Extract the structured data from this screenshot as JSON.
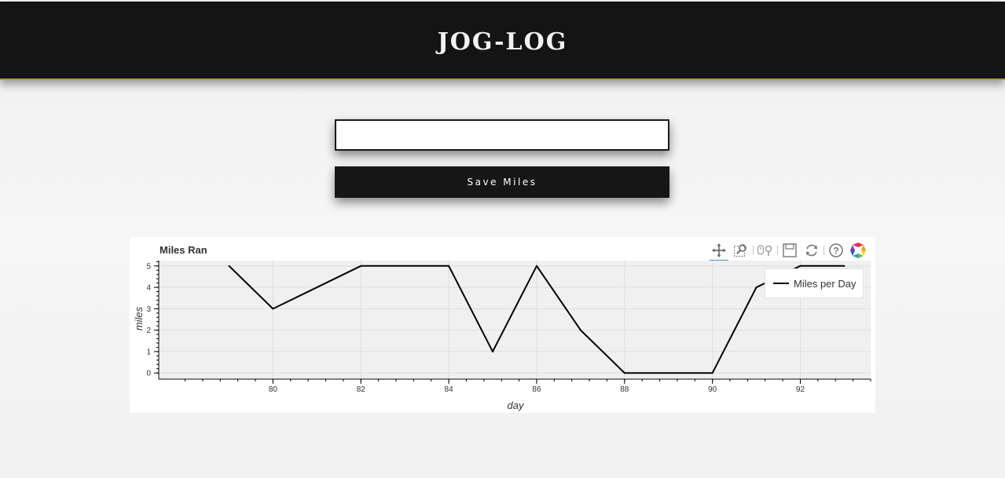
{
  "header": {
    "title": "JOG-LOG"
  },
  "form": {
    "miles_input_value": "",
    "save_label": "Save Miles"
  },
  "plot": {
    "title": "Miles Ran",
    "toolbar": [
      {
        "name": "pan-tool",
        "icon": "pan-icon",
        "active": true
      },
      {
        "name": "box-zoom-tool",
        "icon": "box-zoom-icon"
      },
      {
        "name": "wheel-zoom-tool",
        "icon": "wheel-zoom-icon"
      },
      {
        "name": "save-tool",
        "icon": "save-icon"
      },
      {
        "name": "reset-tool",
        "icon": "reset-icon"
      },
      {
        "name": "help-tool",
        "icon": "help-icon"
      },
      {
        "name": "bokeh-logo",
        "icon": "bokeh-logo-icon"
      }
    ],
    "legend_label": "Miles per Day",
    "accent_color": "#3e93d6"
  },
  "chart_data": {
    "type": "line",
    "title": "Miles Ran",
    "xlabel": "day",
    "ylabel": "miles",
    "x": [
      79,
      80,
      82,
      84,
      85,
      86,
      87,
      88,
      90,
      91,
      92,
      93
    ],
    "series": [
      {
        "name": "Miles per Day",
        "values": [
          5,
          3,
          5,
          5,
          1,
          5,
          2,
          0,
          0,
          4,
          5,
          5
        ]
      }
    ],
    "xlim": [
      77.4,
      93.6
    ],
    "ylim": [
      -0.25,
      5.25
    ],
    "xticks": [
      "80",
      "82",
      "84",
      "86",
      "88",
      "90",
      "92"
    ],
    "yticks": [
      "0",
      "1",
      "2",
      "3",
      "4",
      "5"
    ],
    "grid": true,
    "legend_position": "top-right",
    "line_color": "#000000",
    "plot_background": "#f0f0f0"
  }
}
